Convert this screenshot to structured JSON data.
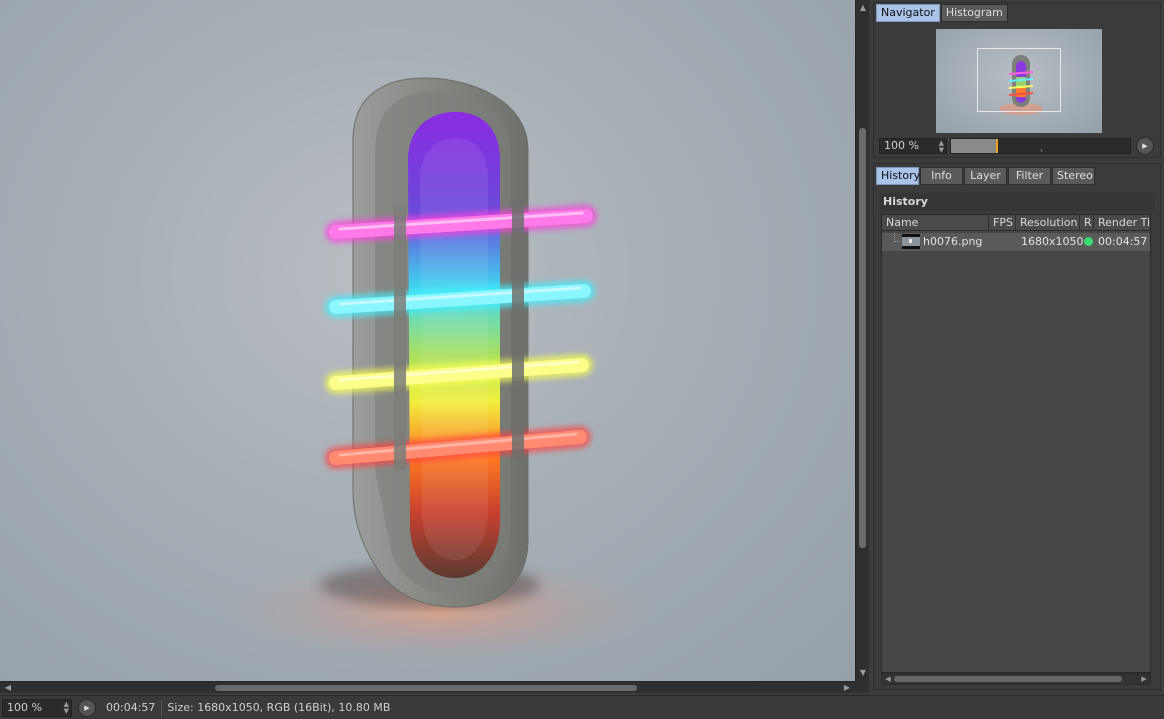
{
  "render": {
    "accent_colors": {
      "magenta": "#ff45e0",
      "cyan": "#40f2ff",
      "yellow": "#fbff63",
      "red": "#ff4d4d"
    }
  },
  "viewport": {
    "scroll_left_icon": "arrow-left-icon",
    "scroll_right_icon": "arrow-right-icon",
    "scroll_up_icon": "arrow-up-icon",
    "scroll_down_icon": "arrow-down-icon"
  },
  "navigator": {
    "tabs": [
      {
        "label": "Navigator",
        "active": true
      },
      {
        "label": "Histogram",
        "active": false
      }
    ],
    "zoom": "100 %",
    "zoom_slider_fraction": 0.25
  },
  "history_panel": {
    "tabs": [
      {
        "label": "History",
        "active": true
      },
      {
        "label": "Info",
        "active": false
      },
      {
        "label": "Layer",
        "active": false
      },
      {
        "label": "Filter",
        "active": false
      },
      {
        "label": "Stereo",
        "active": false
      }
    ],
    "title": "History",
    "columns": [
      "Name",
      "FPS",
      "Resolution",
      "R",
      "Render Tir"
    ],
    "rows": [
      {
        "name": "h0076.png",
        "fps": "",
        "resolution": "1680x1050",
        "status_color": "#3ddc74",
        "render_time": "00:04:57"
      }
    ]
  },
  "statusbar": {
    "zoom": "100 %",
    "time": "00:04:57",
    "info": "Size: 1680x1050, RGB (16Bit), 10.80 MB"
  }
}
